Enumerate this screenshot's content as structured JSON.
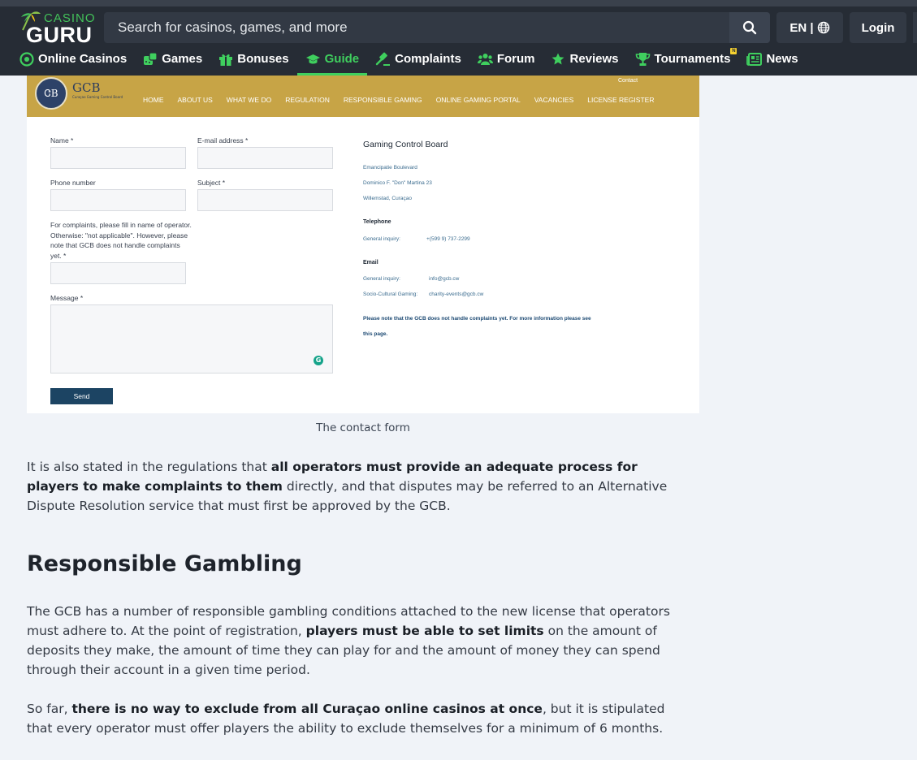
{
  "header": {
    "logo_top": "CASINO",
    "logo_bottom": "GURU",
    "search_placeholder": "Search for casinos, games, and more",
    "language": "EN |",
    "login": "Login",
    "nav": [
      {
        "label": "Online Casinos",
        "icon": "chip-icon"
      },
      {
        "label": "Games",
        "icon": "dice-icon"
      },
      {
        "label": "Bonuses",
        "icon": "gift-icon"
      },
      {
        "label": "Guide",
        "icon": "graduation-cap-icon",
        "active": true
      },
      {
        "label": "Complaints",
        "icon": "gavel-icon"
      },
      {
        "label": "Forum",
        "icon": "users-icon"
      },
      {
        "label": "Reviews",
        "icon": "star-icon"
      },
      {
        "label": "Tournaments",
        "icon": "trophy-icon",
        "badge": "N"
      },
      {
        "label": "News",
        "icon": "newspaper-icon"
      }
    ],
    "accent": "#3fcf5e"
  },
  "screenshot": {
    "org_short": "GCB",
    "org_sub": "Curaçao Gaming Control Board",
    "contact_link": "Contact",
    "menu": [
      "HOME",
      "ABOUT US",
      "WHAT WE DO",
      "REGULATION",
      "RESPONSIBLE GAMING",
      "ONLINE GAMING PORTAL",
      "VACANCIES",
      "LICENSE REGISTER"
    ],
    "form": {
      "name_label": "Name *",
      "email_label": "E-mail address *",
      "phone_label": "Phone number",
      "subject_label": "Subject *",
      "complaint_label": "For complaints, please fill in name of operator. Otherwise: \"not applicable\". However, please note that GCB does not handle complaints yet. *",
      "message_label": "Message *",
      "send": "Send"
    },
    "contact": {
      "title": "Gaming Control Board",
      "address1": "Emancipatie Boulevard",
      "address2": "Dominico F. \"Don\" Martina 23",
      "address3": "Willemstad, Curaçao",
      "telephone_heading": "Telephone",
      "phone_label": "General inquiry:",
      "phone_value": "+(599 9) 737-2299",
      "email_heading": "Email",
      "email_label1": "General inquiry:",
      "email_value1": "info@gcb.cw",
      "email_label2": "Socio-Cultural Gaming:",
      "email_value2": "charity-events@gcb.cw",
      "note1": "Please note that the GCB does not handle complaints yet. For more information please see",
      "note2": "this page."
    }
  },
  "article": {
    "caption": "The contact form",
    "p1_a": "It is also stated in the regulations that ",
    "p1_b": "all operators must provide an adequate process for players to make complaints to them",
    "p1_c": " directly, and that disputes may be referred to an Alternative Dispute Resolution service that must first be approved by the GCB.",
    "heading": "Responsible Gambling",
    "p2_a": "The GCB has a number of responsible gambling conditions attached to the new license that operators must adhere to. At the point of registration, ",
    "p2_b": "players must be able to set limits",
    "p2_c": " on the amount of deposits they make, the amount of time they can play for and the amount of money they can spend through their account in a given time period.",
    "p3_a": "So far, ",
    "p3_b": "there is no way to exclude from all Curaçao online casinos at once",
    "p3_c": ", but it is stipulated that every operator must offer players the ability to exclude themselves for a minimum of 6 months."
  }
}
